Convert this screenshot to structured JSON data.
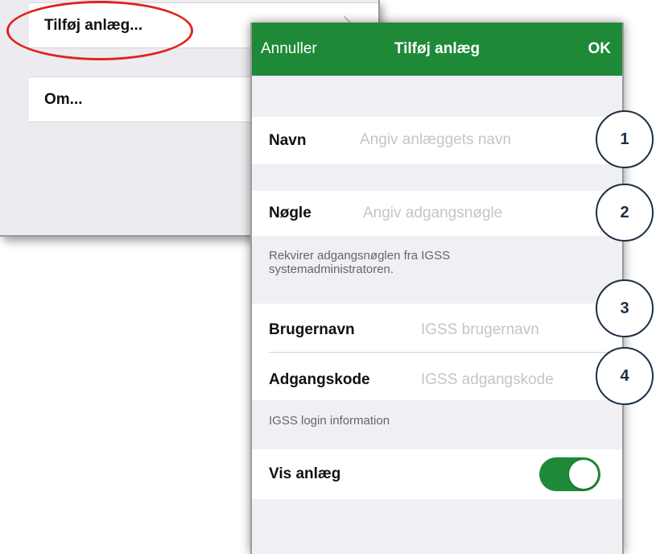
{
  "menu": {
    "items": [
      {
        "label": "Tilføj anlæg..."
      },
      {
        "label": "Om..."
      }
    ]
  },
  "dialog": {
    "cancel": "Annuller",
    "title": "Tilføj anlæg",
    "ok": "OK",
    "fields": {
      "name": {
        "label": "Navn",
        "placeholder": "Angiv anlæggets navn"
      },
      "key": {
        "label": "Nøgle",
        "placeholder": "Angiv adgangsnøgle"
      },
      "key_footer": "Rekvirer adgangsnøglen fra IGSS systemadministratoren.",
      "username": {
        "label": "Brugernavn",
        "placeholder": "IGSS brugernavn"
      },
      "password": {
        "label": "Adgangskode",
        "placeholder": "IGSS adgangskode"
      },
      "login_footer": "IGSS login information",
      "show": {
        "label": "Vis anlæg",
        "on": true
      }
    }
  },
  "callouts": [
    "1",
    "2",
    "3",
    "4"
  ],
  "colors": {
    "navbar": "#1e8a38",
    "toggle_on": "#1e8a38",
    "highlight_ellipse": "#e0241e",
    "callout_border": "#1c2f45"
  }
}
